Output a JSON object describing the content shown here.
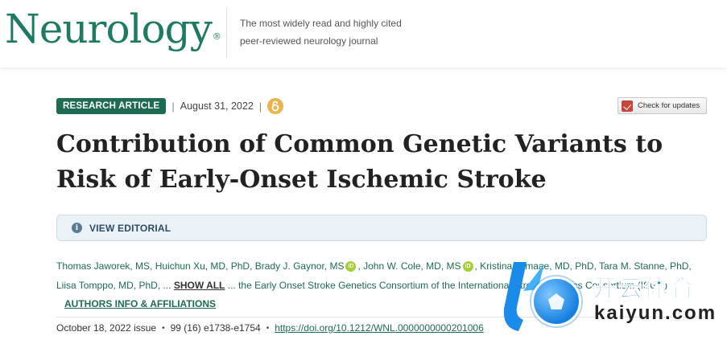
{
  "header": {
    "logo_text": "Neurology",
    "logo_mark": "®",
    "tagline_line1": "The most widely read and highly cited",
    "tagline_line2": "peer-reviewed neurology journal"
  },
  "article": {
    "type_badge": "RESEARCH ARTICLE",
    "separator": "|",
    "date": "August 31, 2022",
    "open_access_icon": "open-access-icon",
    "check_updates_label": "Check for updates",
    "title": "Contribution of Common Genetic Variants to Risk of Early-Onset Ischemic Stroke",
    "editorial_label": "VIEW EDITORIAL"
  },
  "authors": {
    "part1": "Thomas Jaworek, MS, Huichun Xu, MD, PhD, Brady J. Gaynor, MS",
    "part2": ", John W. Cole, MD, MS",
    "part3": ", Kristina Ilamaae, MD, PhD, Tara M. Stanne, PhD, Liisa Tomppo, MD, PhD, ...",
    "show_all": "SHOW ALL",
    "part4": "... the Early Onset Stroke Genetics Consortium of the International Stroke Genetics Consortium (ISGC)",
    "affiliations_link": "AUTHORS INFO & AFFILIATIONS"
  },
  "citation": {
    "issue": "October 18, 2022 issue",
    "volume_pages": "99 (16) e1738-e1754",
    "bullet": "•",
    "doi": "https://doi.org/10.1212/WNL.0000000000201006"
  },
  "watermark": {
    "chinese_text": "开云体育",
    "latin_text": "kaiyun.com"
  },
  "colors": {
    "brand_green": "#1d6b53",
    "logo_green": "#1f7a63",
    "editorial_bg": "#eaf2f8",
    "orcid_green": "#a6ce39",
    "oa_orange": "#e9b44c"
  }
}
